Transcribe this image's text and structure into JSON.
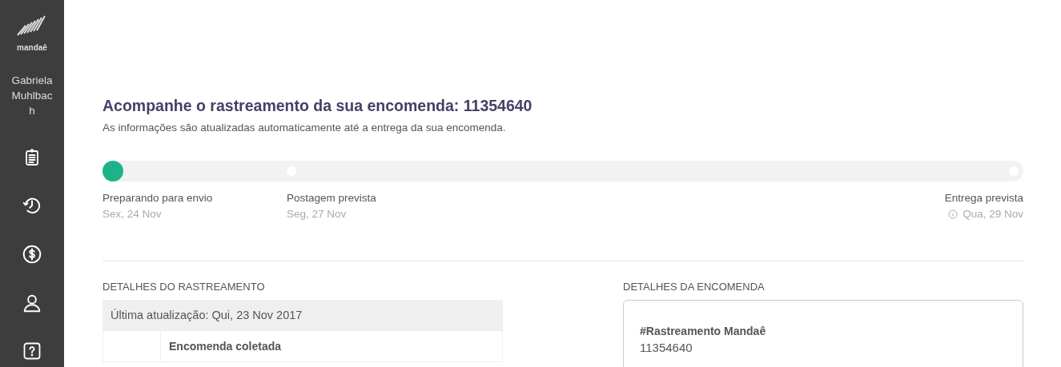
{
  "sidebar": {
    "brand": "mandaê",
    "user_name": "Gabriela Muhlbach",
    "nav": [
      {
        "kind": "clipboard"
      },
      {
        "kind": "history"
      },
      {
        "kind": "money"
      },
      {
        "kind": "profile"
      },
      {
        "kind": "help"
      }
    ]
  },
  "header": {
    "title": "Acompanhe o rastreamento da sua encomenda: 11354640",
    "subtitle": "As informações são atualizadas automaticamente até a entrega da sua encomenda."
  },
  "progress": {
    "steps": [
      {
        "label": "Preparando para envio",
        "date": "Sex, 24 Nov",
        "completed": true,
        "info": false
      },
      {
        "label": "Postagem prevista",
        "date": "Seg, 27 Nov",
        "completed": false,
        "info": false
      },
      {
        "label": "Entrega prevista",
        "date": "Qua, 29 Nov",
        "completed": false,
        "info": true
      }
    ]
  },
  "tracking": {
    "heading": "DETALHES DO RASTREAMENTO",
    "last_update": "Última atualização: Qui, 23 Nov 2017",
    "events": [
      {
        "title": "Encomenda coletada"
      }
    ]
  },
  "order": {
    "heading": "DETALHES DA ENCOMENDA",
    "fields": [
      {
        "label": "#Rastreamento Mandaê",
        "value": "11354640"
      }
    ]
  }
}
